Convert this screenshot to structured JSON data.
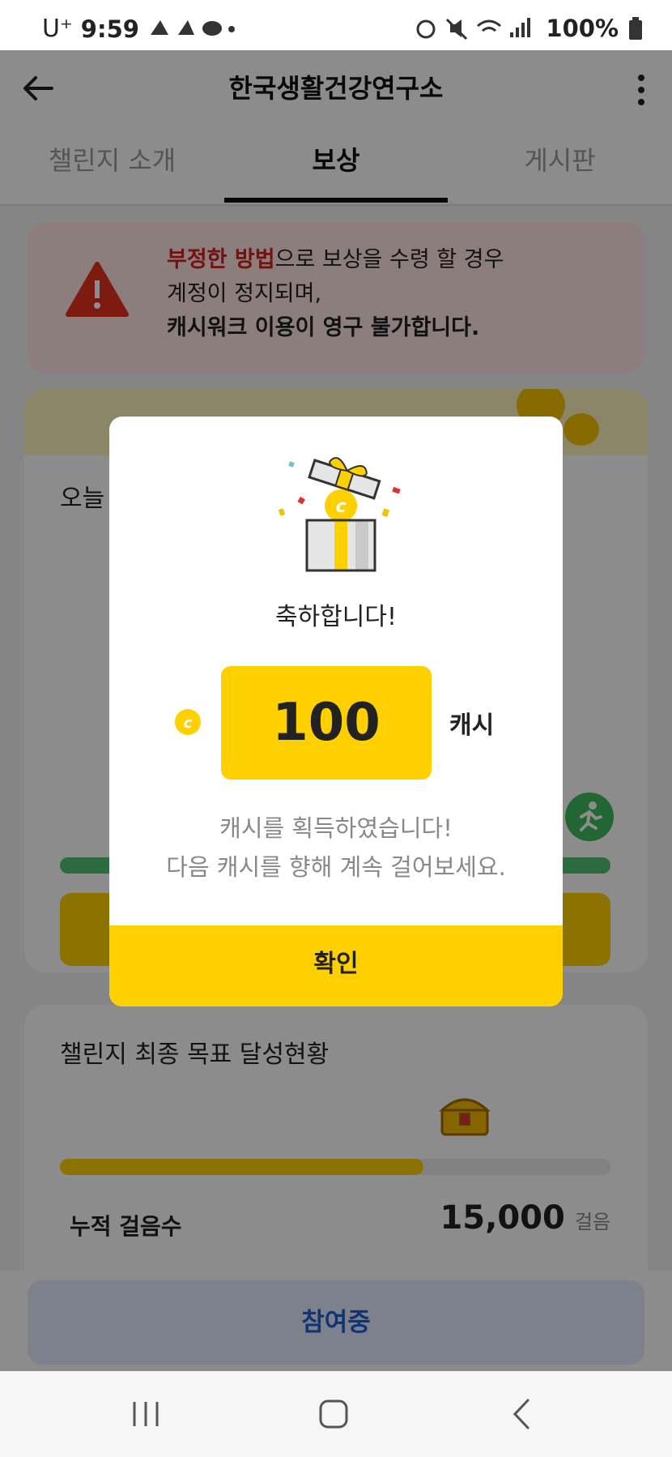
{
  "status_bar": {
    "carrier": "U⁺",
    "time": "9:59",
    "battery": "100%"
  },
  "header": {
    "title": "한국생활건강연구소"
  },
  "tabs": [
    {
      "label": "챌린지 소개",
      "active": false
    },
    {
      "label": "보상",
      "active": true
    },
    {
      "label": "게시판",
      "active": false
    }
  ],
  "warning": {
    "line1_red": "부정한 방법",
    "line1_rest": "으로 보상을 수령 할 경우",
    "line2": "계정이 정지되며,",
    "line3": "캐시워크 이용이 영구 불가합니다."
  },
  "daily_card": {
    "label_partial": "오늘"
  },
  "final_goal": {
    "title": "챌린지 최종 목표 달성현황",
    "progress_fraction": 0.66,
    "accumulated_label": "누적 걸음수",
    "accumulated_value": "15,000",
    "accumulated_unit": "걸음"
  },
  "join_button": {
    "label": "참여중"
  },
  "dialog": {
    "congrats": "축하합니다!",
    "amount": "100",
    "unit": "캐시",
    "message_line1": "캐시를 획득하였습니다!",
    "message_line2": "다음 캐시를 향해 계속 걸어보세요.",
    "confirm_label": "확인"
  },
  "colors": {
    "accent_yellow": "#ffd000",
    "warning_red": "#d32222",
    "join_blue": "#1f5fd8",
    "progress_green": "#4fc46f"
  }
}
